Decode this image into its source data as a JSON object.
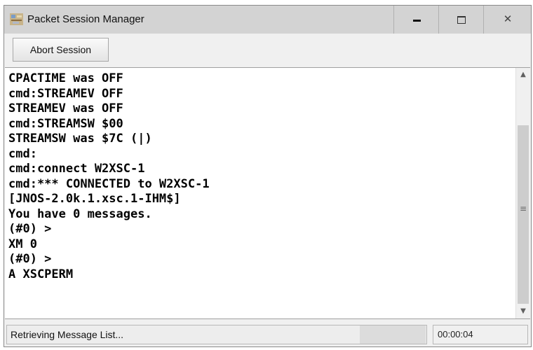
{
  "window": {
    "title": "Packet Session Manager",
    "app_icon": "packet-app-icon"
  },
  "toolbar": {
    "abort_label": "Abort Session"
  },
  "console": {
    "lines": [
      "CPACTIME was OFF",
      "cmd:STREAMEV OFF",
      "STREAMEV was OFF",
      "cmd:STREAMSW $00",
      "STREAMSW was $7C (|)",
      "cmd:",
      "cmd:connect W2XSC-1",
      "cmd:*** CONNECTED to W2XSC-1",
      "[JNOS-2.0k.1.xsc.1-IHM$]",
      "You have 0 messages.",
      "(#0) >",
      "XM 0",
      "(#0) >",
      "A XSCPERM"
    ]
  },
  "status": {
    "message": "Retrieving Message List...",
    "elapsed": "00:00:04"
  },
  "colors": {
    "titlebar": "#d3d3d3",
    "window_bg": "#f0f0f0",
    "console_bg": "#ffffff",
    "console_text": "#000000"
  }
}
